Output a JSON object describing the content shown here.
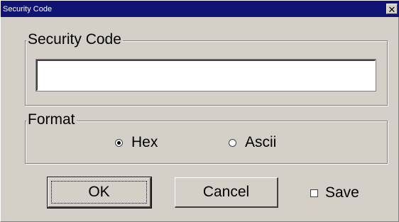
{
  "window": {
    "title": "Security Code",
    "close_glyph": "✕"
  },
  "security_group": {
    "label": "Security Code",
    "input_value": ""
  },
  "format_group": {
    "label": "Format",
    "options": [
      {
        "label": "Hex",
        "selected": true
      },
      {
        "label": "Ascii",
        "selected": false
      }
    ]
  },
  "buttons": {
    "ok_label": "OK",
    "cancel_label": "Cancel"
  },
  "save_checkbox": {
    "label": "Save",
    "checked": false
  },
  "colors": {
    "titlebar": "#101473",
    "dialog_face": "#d4d0c8"
  },
  "icons": {
    "close": "close-icon",
    "radio": "radio-button-icon",
    "checkbox": "checkbox-icon"
  }
}
